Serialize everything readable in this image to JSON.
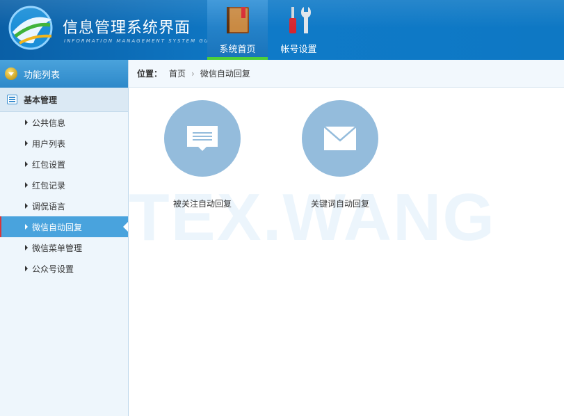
{
  "header": {
    "title": "信息管理系统界面",
    "subtitle": "INFORMATION MANAGEMENT SYSTEM GUI",
    "logo_icon": "globe-logo-icon",
    "tabs": [
      {
        "label": "系统首页",
        "icon": "book-icon",
        "active": true
      },
      {
        "label": "帐号设置",
        "icon": "tools-icon",
        "active": false
      }
    ],
    "colors": {
      "primary": "#0e78c4",
      "active_tab_underline": "#4dcf3a"
    }
  },
  "sidebar": {
    "title": "功能列表",
    "group": "基本管理",
    "items": [
      {
        "label": "公共信息"
      },
      {
        "label": "用户列表"
      },
      {
        "label": "红包设置"
      },
      {
        "label": "红包记录"
      },
      {
        "label": "调侃语言"
      },
      {
        "label": "微信自动回复",
        "active": true
      },
      {
        "label": "微信菜单管理"
      },
      {
        "label": "公众号设置"
      }
    ]
  },
  "breadcrumb": {
    "label": "位置：",
    "items": [
      "首页",
      "微信自动回复"
    ]
  },
  "content": {
    "watermark": "TEX.WANG",
    "tiles": [
      {
        "label": "被关注自动回复",
        "icon": "message-icon"
      },
      {
        "label": "关键词自动回复",
        "icon": "envelope-icon"
      }
    ],
    "colors": {
      "tile_disc": "#94bcdc"
    }
  }
}
